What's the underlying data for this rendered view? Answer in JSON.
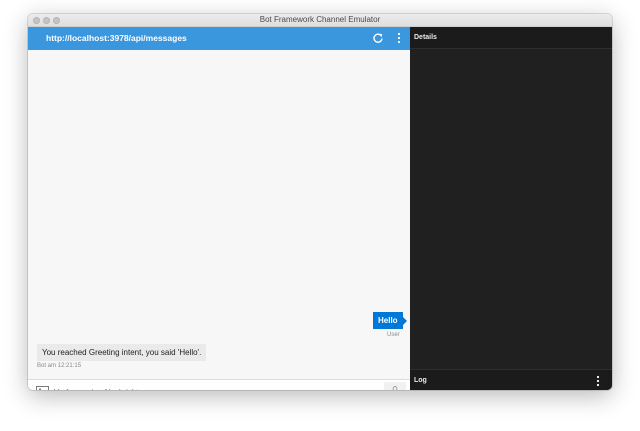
{
  "window": {
    "title": "Bot Framework Channel Emulator"
  },
  "chat": {
    "endpoint_url": "http://localhost:3978/api/messages",
    "messages": [
      {
        "from": "user",
        "text": "Hello",
        "meta": "User"
      },
      {
        "from": "bot",
        "text": "You reached Greeting intent, you said 'Hello'.",
        "meta": "Bot am 12:21:15"
      }
    ],
    "composer": {
      "placeholder": "Verfasse eine Nachricht..."
    }
  },
  "details": {
    "title": "Details"
  },
  "log": {
    "title": "Log"
  },
  "colors": {
    "accent": "#3a96dd",
    "user_bubble": "#0078d7",
    "panel_dark": "#202020"
  }
}
